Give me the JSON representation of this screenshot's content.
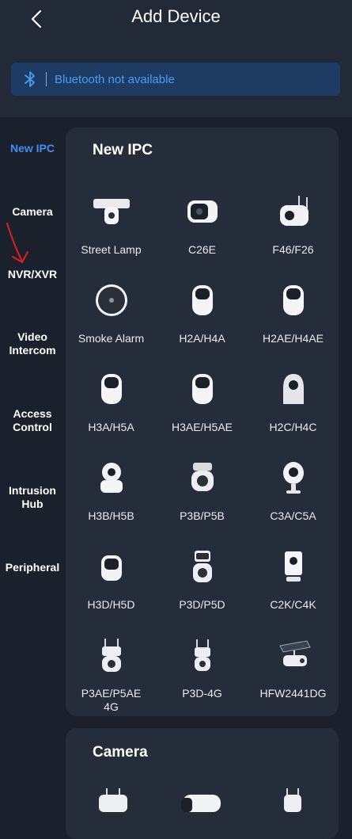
{
  "header": {
    "title": "Add Device",
    "back_icon": "chevron-left-icon",
    "bluetooth": {
      "icon": "bluetooth-icon",
      "text": "Bluetooth not available"
    }
  },
  "sidebar": {
    "items": [
      {
        "label": "New IPC",
        "active": true
      },
      {
        "label": "Camera",
        "active": false
      },
      {
        "label": "NVR/XVR",
        "active": false
      },
      {
        "label": "Video Intercom",
        "active": false
      },
      {
        "label": "Access Control",
        "active": false
      },
      {
        "label": "Intrusion Hub",
        "active": false
      },
      {
        "label": "Peripheral",
        "active": false
      }
    ]
  },
  "sections": [
    {
      "title": "New IPC",
      "devices": [
        {
          "name": "Street Lamp"
        },
        {
          "name": "C26E"
        },
        {
          "name": "F46/F26"
        },
        {
          "name": "Smoke Alarm"
        },
        {
          "name": "H2A/H4A"
        },
        {
          "name": "H2AE/H4AE"
        },
        {
          "name": "H3A/H5A"
        },
        {
          "name": "H3AE/H5AE"
        },
        {
          "name": "H2C/H4C"
        },
        {
          "name": "H3B/H5B"
        },
        {
          "name": "P3B/P5B"
        },
        {
          "name": "C3A/C5A"
        },
        {
          "name": "H3D/H5D"
        },
        {
          "name": "P3D/P5D"
        },
        {
          "name": "C2K/C4K"
        },
        {
          "name": "P3AE/P5AE 4G"
        },
        {
          "name": "P3D-4G"
        },
        {
          "name": "HFW2441DG"
        }
      ]
    },
    {
      "title": "Camera",
      "devices": []
    }
  ],
  "colors": {
    "accent": "#3d8df5",
    "banner_bg": "#1e3b63",
    "banner_text": "#4a9cf1",
    "annotation": "#e02020"
  }
}
